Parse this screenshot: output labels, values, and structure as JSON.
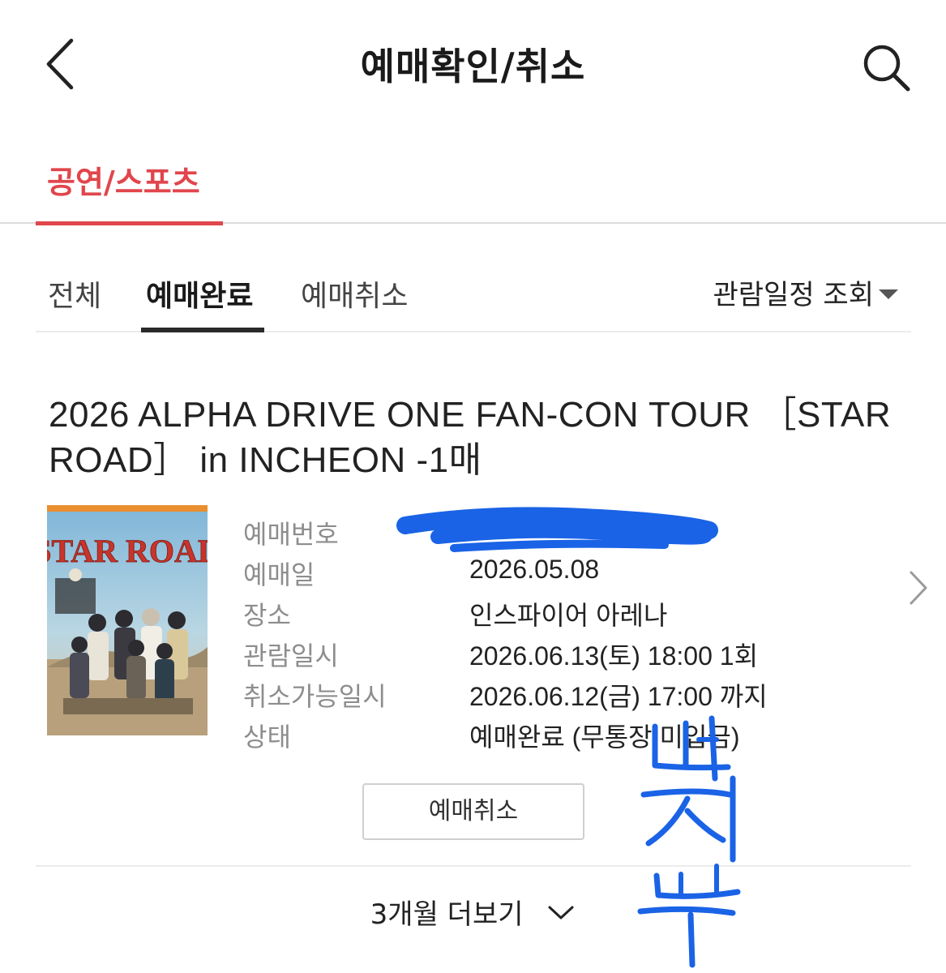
{
  "header": {
    "title": "예매확인/취소",
    "back_icon": "chevron-left-icon",
    "search_icon": "search-icon"
  },
  "category_tabs": [
    {
      "label": "공연/스포츠",
      "active": true
    }
  ],
  "filter_tabs": [
    {
      "label": "전체",
      "active": false
    },
    {
      "label": "예매완료",
      "active": true
    },
    {
      "label": "예매취소",
      "active": false
    }
  ],
  "schedule_filter": {
    "label": "관람일정 조회"
  },
  "booking": {
    "title": "2026 ALPHA DRIVE ONE FAN-CON TOUR ［STAR ROAD］ in INCHEON -1매",
    "poster_text": "STAR ROAD",
    "fields": [
      {
        "label": "예매번호",
        "value": ""
      },
      {
        "label": "예매일",
        "value": "2026.05.08"
      },
      {
        "label": "장소",
        "value": "인스파이어 아레나"
      },
      {
        "label": "관람일시",
        "value": "2026.06.13(토) 18:00 1회"
      },
      {
        "label": "취소가능일시",
        "value": "2026.06.12(금) 17:00 까지"
      },
      {
        "label": "상태",
        "value": "예매완료 (무통장 미입금)"
      }
    ],
    "cancel_button": "예매취소"
  },
  "more_button": {
    "label": "3개월 더보기"
  },
  "colors": {
    "accent": "#e0464c",
    "scribble": "#1a63e6"
  }
}
